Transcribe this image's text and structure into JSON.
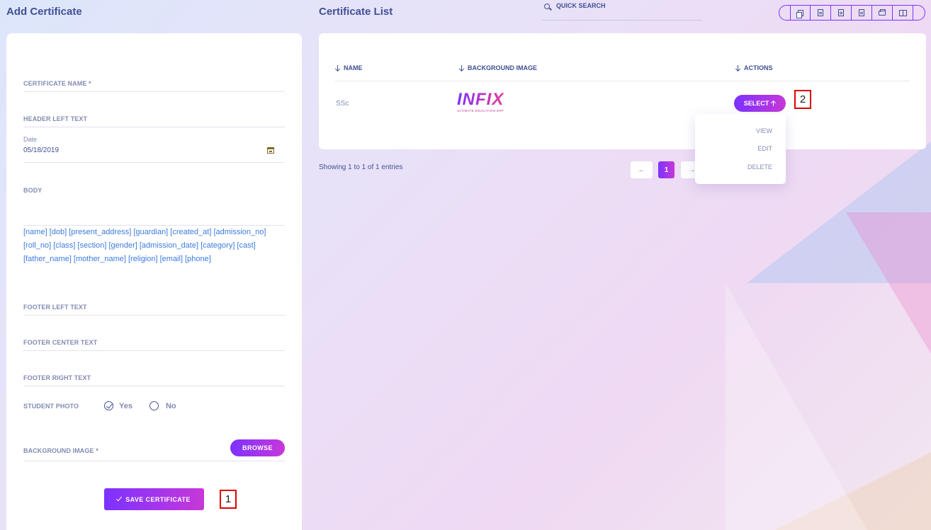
{
  "left_title": "Add Certificate",
  "right_title": "Certificate List",
  "search": {
    "placeholder": "QUICK SEARCH"
  },
  "export_buttons": [
    "copy-icon",
    "excel-icon",
    "csv-icon",
    "pdf-icon",
    "print-icon",
    "columns-icon"
  ],
  "form": {
    "certificate_name_label": "CERTIFICATE NAME *",
    "header_left_label": "HEADER LEFT TEXT",
    "date_label": "Date",
    "date_value": "05/18/2019",
    "body_label": "BODY",
    "tags": "[name] [dob] [present_address] [guardian] [created_at] [admission_no] [roll_no] [class] [section] [gender] [admission_date] [category] [cast] [father_name] [mother_name] [religion] [email] [phone]",
    "footer_left_label": "FOOTER LEFT TEXT",
    "footer_center_label": "FOOTER CENTER TEXT",
    "footer_right_label": "FOOTER RIGHT TEXT",
    "student_photo_label": "STUDENT PHOTO",
    "photo_yes": "Yes",
    "photo_no": "No",
    "photo_selected": "Yes",
    "background_image_label": "BACKGROUND IMAGE *",
    "browse_label": "BROWSE",
    "save_label": "SAVE CERTIFICATE"
  },
  "table": {
    "headers": [
      "NAME",
      "BACKGROUND IMAGE",
      "ACTIONS"
    ],
    "rows": [
      {
        "name": "SSc",
        "logo_text": "INFIX",
        "logo_sub": "ULTIMATE EDUCATION ERP",
        "action": "SELECT"
      }
    ]
  },
  "dropdown": [
    "VIEW",
    "EDIT",
    "DELETE"
  ],
  "showing": "Showing 1 to 1 of 1 entries",
  "pagination": {
    "current": "1"
  },
  "markers": [
    "1",
    "2"
  ],
  "colors": {
    "accent_start": "#7c32ff",
    "accent_end": "#c738d8",
    "text": "#415094",
    "muted": "#828bb2"
  }
}
